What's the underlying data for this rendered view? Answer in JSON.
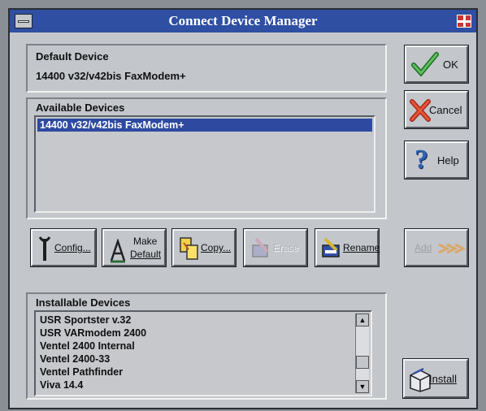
{
  "window": {
    "title": "Connect Device Manager"
  },
  "default_device": {
    "label": "Default Device",
    "value": "14400 v32/v42bis FaxModem+"
  },
  "available_devices": {
    "label": "Available Devices",
    "items": [
      "14400 v32/v42bis FaxModem+"
    ]
  },
  "actions": {
    "config": "Config...",
    "make_default_line1": "Make",
    "make_default_line2": "Default",
    "copy": "Copy...",
    "erase": "Erase",
    "rename": "Rename"
  },
  "side_buttons": {
    "ok": "OK",
    "cancel": "Cancel",
    "help": "Help",
    "add": "Add",
    "install": "Install"
  },
  "installable_devices": {
    "label": "Installable Devices",
    "items": [
      "USR Sportster v.32",
      "USR VARmodem 2400",
      "Ventel 2400 Internal",
      "Ventel 2400-33",
      "Ventel Pathfinder",
      "Viva 14.4"
    ]
  },
  "colors": {
    "titlebar": "#2f4fa3",
    "selection": "#2e4aa0",
    "face": "#c3c6cb"
  },
  "icons": [
    "system-menu-icon",
    "window-flag-icon",
    "checkmark-icon",
    "x-icon",
    "question-mark-icon",
    "wrench-icon",
    "make-default-icon",
    "copy-icon",
    "erase-icon",
    "rename-icon",
    "add-arrow-icon",
    "install-box-icon",
    "scroll-up-icon",
    "scroll-down-icon"
  ]
}
